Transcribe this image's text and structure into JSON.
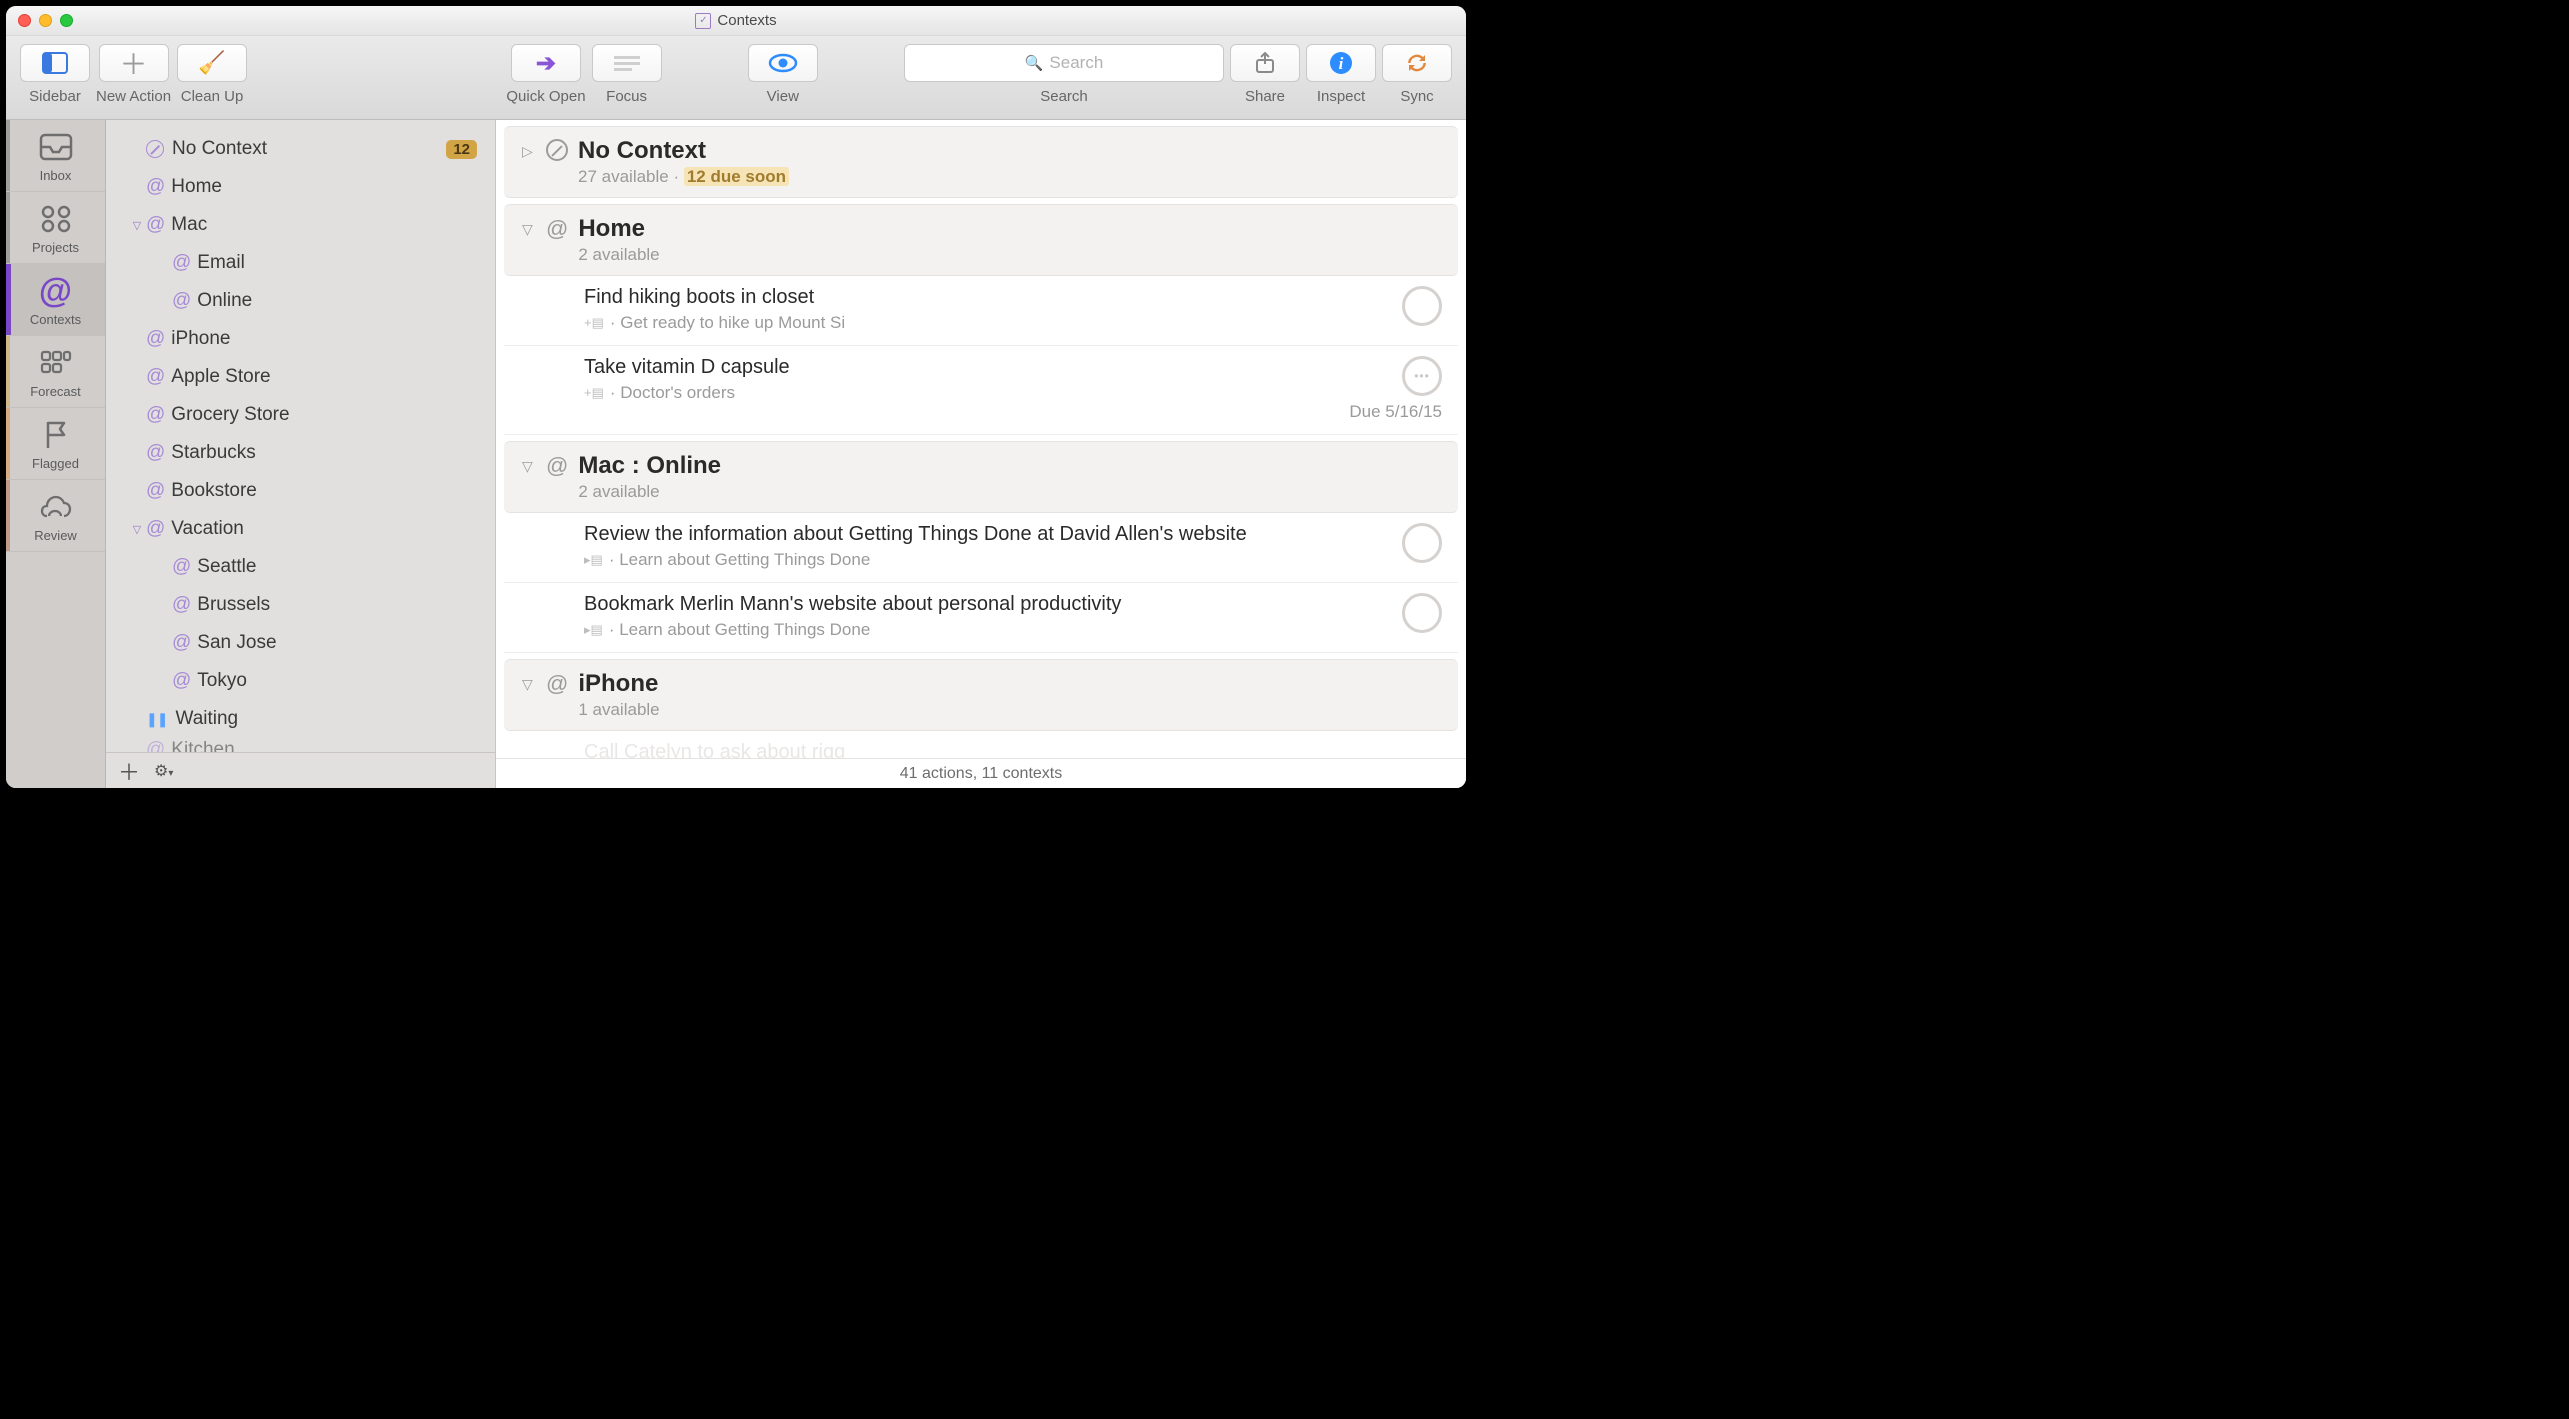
{
  "window_title": "Contexts",
  "toolbar": {
    "sidebar": "Sidebar",
    "new_action": "New Action",
    "clean_up": "Clean Up",
    "quick_open": "Quick Open",
    "focus": "Focus",
    "view": "View",
    "search_placeholder": "Search",
    "search_label": "Search",
    "share": "Share",
    "inspect": "Inspect",
    "sync": "Sync"
  },
  "perspectives": [
    {
      "id": "inbox",
      "label": "Inbox",
      "selected": false,
      "accent": "#6e6e6e"
    },
    {
      "id": "projects",
      "label": "Projects",
      "selected": false,
      "accent": "#6e6e6e"
    },
    {
      "id": "contexts",
      "label": "Contexts",
      "selected": true,
      "accent": "#7a48c6"
    },
    {
      "id": "forecast",
      "label": "Forecast",
      "selected": false,
      "accent": "#d1a446"
    },
    {
      "id": "flagged",
      "label": "Flagged",
      "selected": false,
      "accent": "#e0893f"
    },
    {
      "id": "review",
      "label": "Review",
      "selected": false,
      "accent": "#b36a4a"
    }
  ],
  "sidebar": {
    "items": [
      {
        "label": "No Context",
        "indent": 0,
        "icon": "no-context",
        "badge": "12"
      },
      {
        "label": "Home",
        "indent": 0,
        "icon": "at"
      },
      {
        "label": "Mac",
        "indent": 0,
        "icon": "at",
        "disclosure": "open"
      },
      {
        "label": "Email",
        "indent": 1,
        "icon": "at"
      },
      {
        "label": "Online",
        "indent": 1,
        "icon": "at"
      },
      {
        "label": "iPhone",
        "indent": 0,
        "icon": "at"
      },
      {
        "label": "Apple Store",
        "indent": 0,
        "icon": "at"
      },
      {
        "label": "Grocery Store",
        "indent": 0,
        "icon": "at"
      },
      {
        "label": "Starbucks",
        "indent": 0,
        "icon": "at"
      },
      {
        "label": "Bookstore",
        "indent": 0,
        "icon": "at"
      },
      {
        "label": "Vacation",
        "indent": 0,
        "icon": "at",
        "disclosure": "open"
      },
      {
        "label": "Seattle",
        "indent": 1,
        "icon": "at"
      },
      {
        "label": "Brussels",
        "indent": 1,
        "icon": "at"
      },
      {
        "label": "San Jose",
        "indent": 1,
        "icon": "at"
      },
      {
        "label": "Tokyo",
        "indent": 1,
        "icon": "at"
      },
      {
        "label": "Waiting",
        "indent": 0,
        "icon": "pause"
      },
      {
        "label": "Kitchen",
        "indent": 0,
        "icon": "at"
      }
    ]
  },
  "main": {
    "groups": [
      {
        "title": "No Context",
        "icon": "no-context",
        "disclosure": "closed",
        "subtitle_available": "27 available",
        "subtitle_due": "12 due soon",
        "tasks": []
      },
      {
        "title": "Home",
        "icon": "at",
        "disclosure": "open",
        "subtitle_available": "2 available",
        "tasks": [
          {
            "title": "Find hiking boots in closet",
            "project": "Get ready to hike up Mount Si",
            "proj_prefix": "+",
            "status": "plain"
          },
          {
            "title": "Take vitamin D capsule",
            "project": "Doctor's orders",
            "proj_prefix": "+",
            "due": "Due 5/16/15",
            "status": "repeat"
          }
        ]
      },
      {
        "title": "Mac : Online",
        "icon": "at",
        "disclosure": "open",
        "subtitle_available": "2 available",
        "tasks": [
          {
            "title": "Review the information about Getting Things Done at David Allen's website",
            "project": "Learn about Getting Things Done",
            "proj_prefix": "▸",
            "status": "plain"
          },
          {
            "title": "Bookmark Merlin Mann's website about personal productivity",
            "project": "Learn about Getting Things Done",
            "proj_prefix": "▸",
            "status": "plain"
          }
        ]
      },
      {
        "title": "iPhone",
        "icon": "at",
        "disclosure": "open",
        "subtitle_available": "1 available",
        "tasks": [],
        "faded_task": "Call Catelyn to ask about rigg"
      }
    ],
    "status_bar": "41 actions, 11 contexts"
  }
}
